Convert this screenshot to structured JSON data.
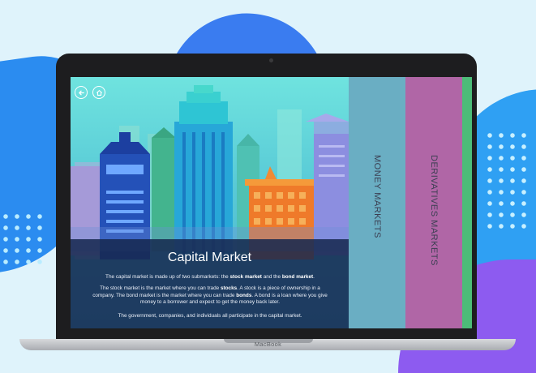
{
  "device": {
    "brand": "MacBook"
  },
  "nav": {
    "back_icon": "arrow-left-icon",
    "home_icon": "home-icon"
  },
  "main": {
    "title": "Capital Market",
    "para1": {
      "before": "The capital market is made up of two submarkets: the ",
      "b1": "stock market",
      "mid": " and the ",
      "b2": "bond market",
      "after": "."
    },
    "para2": {
      "before": "The stock market is the market where you can trade ",
      "b1": "stocks",
      "mid": ". A stock is a piece of ownership in a company. The bond market is the market where you can trade ",
      "b2": "bonds",
      "after": ". A bond is a loan where you give money to a borrower and expect to get the money back later."
    },
    "para3": "The government, companies, and individuals all participate in the capital market."
  },
  "tabs": [
    {
      "label": "MONEY MARKETS",
      "color": "#6aaec3"
    },
    {
      "label": "DERIVATIVES MARKETS",
      "color": "#b066a6"
    }
  ],
  "colors": {
    "panel": "#16284e",
    "accent_green": "#4cbc78"
  }
}
